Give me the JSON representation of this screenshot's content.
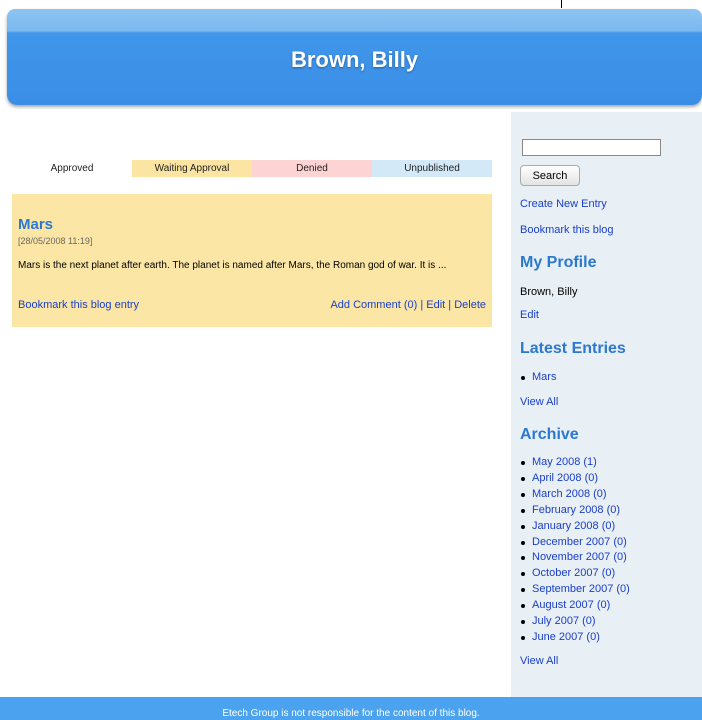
{
  "header": {
    "title": "Brown, Billy"
  },
  "status_legend": [
    {
      "label": "Approved",
      "color": "#ffffff"
    },
    {
      "label": "Waiting Approval",
      "color": "#fce5a2"
    },
    {
      "label": "Denied",
      "color": "#fdd3d3"
    },
    {
      "label": "Unpublished",
      "color": "#d4e9f8"
    }
  ],
  "entry": {
    "title": "Mars",
    "date": "[28/05/2008 11:19]",
    "excerpt": "Mars is the next planet after earth. The planet is named after Mars, the Roman god of war. It is ...",
    "bookmark_label": "Bookmark this blog entry",
    "add_comment_label": "Add Comment (0)",
    "separator": "|",
    "edit_label": "Edit",
    "delete_label": "Delete",
    "status_color": "#fce6a5"
  },
  "sidebar": {
    "search_value": "",
    "search_button": "Search",
    "create_entry": "Create New Entry",
    "bookmark_blog": "Bookmark this blog",
    "profile_heading": "My Profile",
    "profile_name": "Brown, Billy",
    "profile_edit": "Edit",
    "latest_heading": "Latest Entries",
    "latest_entries": [
      "Mars"
    ],
    "latest_view_all": "View All",
    "archive_heading": "Archive",
    "archive": [
      "May 2008 (1)",
      "April 2008 (0)",
      "March 2008 (0)",
      "February 2008 (0)",
      "January 2008 (0)",
      "December 2007 (0)",
      "November 2007 (0)",
      "October 2007 (0)",
      "September 2007 (0)",
      "August 2007 (0)",
      "July 2007 (0)",
      "June 2007 (0)"
    ],
    "archive_view_all": "View All"
  },
  "footer": {
    "text": "Etech Group is not responsible for the content of this blog."
  },
  "colors": {
    "accent": "#2d78cf",
    "header_blue": "#3b8ee6",
    "link": "#1a3fc8",
    "sidebar_bg": "#e8eff5"
  }
}
